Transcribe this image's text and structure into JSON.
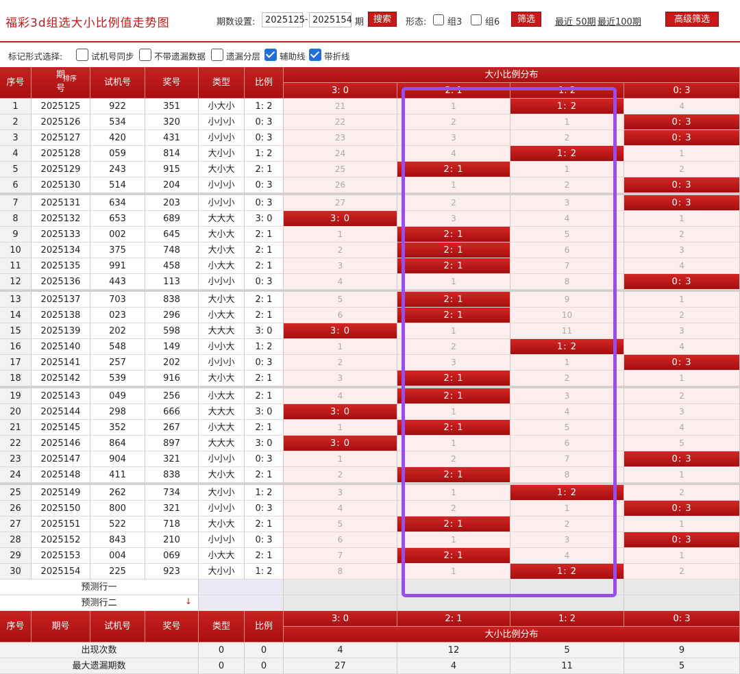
{
  "title": "福彩3d组选大小比例值走势图",
  "toolbar": {
    "period_label": "期数设置:",
    "from": "2025125",
    "dash": "-",
    "to": "2025154",
    "period_unit": "期",
    "search_label": "搜索",
    "form_label": "形态:",
    "group3_label": "组3",
    "group6_label": "组6",
    "filter_label": "筛选",
    "recent50": "最近 50期",
    "recent100": "最近100期",
    "advanced_label": "高级筛选"
  },
  "mark_bar": {
    "label": "标记形式选择:",
    "opt1": "试机号同步",
    "opt2": "不带遗漏数据",
    "opt3": "遗漏分层",
    "opt4": "辅助线",
    "opt5": "带折线",
    "opt4_checked": true,
    "opt5_checked": true
  },
  "headers": {
    "idx": "序号",
    "issue": "期号",
    "sort": "排序",
    "trial": "试机号",
    "draw": "奖号",
    "type": "类型",
    "ratio": "比例",
    "dist": "大小比例分布",
    "cats": [
      "3:0",
      "2:1",
      "1:2",
      "0:3"
    ]
  },
  "rows": [
    {
      "i": "1",
      "issue": "2025125",
      "trial": "922",
      "draw": "351",
      "type": "小大小",
      "ratio": "1:2",
      "d": [
        "21",
        "1",
        "1:2",
        "4"
      ],
      "hit": 2
    },
    {
      "i": "2",
      "issue": "2025126",
      "trial": "534",
      "draw": "320",
      "type": "小小小",
      "ratio": "0:3",
      "d": [
        "22",
        "2",
        "1",
        "0:3"
      ],
      "hit": 3
    },
    {
      "i": "3",
      "issue": "2025127",
      "trial": "420",
      "draw": "431",
      "type": "小小小",
      "ratio": "0:3",
      "d": [
        "23",
        "3",
        "2",
        "0:3"
      ],
      "hit": 3
    },
    {
      "i": "4",
      "issue": "2025128",
      "trial": "059",
      "draw": "814",
      "type": "大小小",
      "ratio": "1:2",
      "d": [
        "24",
        "4",
        "1:2",
        "1"
      ],
      "hit": 2
    },
    {
      "i": "5",
      "issue": "2025129",
      "trial": "243",
      "draw": "915",
      "type": "大小大",
      "ratio": "2:1",
      "d": [
        "25",
        "2:1",
        "1",
        "2"
      ],
      "hit": 1
    },
    {
      "i": "6",
      "issue": "2025130",
      "trial": "514",
      "draw": "204",
      "type": "小小小",
      "ratio": "0:3",
      "d": [
        "26",
        "1",
        "2",
        "0:3"
      ],
      "hit": 3
    },
    {
      "i": "7",
      "issue": "2025131",
      "trial": "634",
      "draw": "203",
      "type": "小小小",
      "ratio": "0:3",
      "d": [
        "27",
        "2",
        "3",
        "0:3"
      ],
      "hit": 3
    },
    {
      "i": "8",
      "issue": "2025132",
      "trial": "653",
      "draw": "689",
      "type": "大大大",
      "ratio": "3:0",
      "d": [
        "3:0",
        "3",
        "4",
        "1"
      ],
      "hit": 0
    },
    {
      "i": "9",
      "issue": "2025133",
      "trial": "002",
      "draw": "645",
      "type": "大小大",
      "ratio": "2:1",
      "d": [
        "1",
        "2:1",
        "5",
        "2"
      ],
      "hit": 1
    },
    {
      "i": "10",
      "issue": "2025134",
      "trial": "375",
      "draw": "748",
      "type": "大小大",
      "ratio": "2:1",
      "d": [
        "2",
        "2:1",
        "6",
        "3"
      ],
      "hit": 1
    },
    {
      "i": "11",
      "issue": "2025135",
      "trial": "991",
      "draw": "458",
      "type": "小大大",
      "ratio": "2:1",
      "d": [
        "3",
        "2:1",
        "7",
        "4"
      ],
      "hit": 1
    },
    {
      "i": "12",
      "issue": "2025136",
      "trial": "443",
      "draw": "113",
      "type": "小小小",
      "ratio": "0:3",
      "d": [
        "4",
        "1",
        "8",
        "0:3"
      ],
      "hit": 3
    },
    {
      "i": "13",
      "issue": "2025137",
      "trial": "703",
      "draw": "838",
      "type": "大小大",
      "ratio": "2:1",
      "d": [
        "5",
        "2:1",
        "9",
        "1"
      ],
      "hit": 1
    },
    {
      "i": "14",
      "issue": "2025138",
      "trial": "023",
      "draw": "296",
      "type": "小大大",
      "ratio": "2:1",
      "d": [
        "6",
        "2:1",
        "10",
        "2"
      ],
      "hit": 1
    },
    {
      "i": "15",
      "issue": "2025139",
      "trial": "202",
      "draw": "598",
      "type": "大大大",
      "ratio": "3:0",
      "d": [
        "3:0",
        "1",
        "11",
        "3"
      ],
      "hit": 0
    },
    {
      "i": "16",
      "issue": "2025140",
      "trial": "548",
      "draw": "149",
      "type": "小小大",
      "ratio": "1:2",
      "d": [
        "1",
        "2",
        "1:2",
        "4"
      ],
      "hit": 2
    },
    {
      "i": "17",
      "issue": "2025141",
      "trial": "257",
      "draw": "202",
      "type": "小小小",
      "ratio": "0:3",
      "d": [
        "2",
        "3",
        "1",
        "0:3"
      ],
      "hit": 3
    },
    {
      "i": "18",
      "issue": "2025142",
      "trial": "539",
      "draw": "916",
      "type": "大小大",
      "ratio": "2:1",
      "d": [
        "3",
        "2:1",
        "2",
        "1"
      ],
      "hit": 1
    },
    {
      "i": "19",
      "issue": "2025143",
      "trial": "049",
      "draw": "256",
      "type": "小大大",
      "ratio": "2:1",
      "d": [
        "4",
        "2:1",
        "3",
        "2"
      ],
      "hit": 1
    },
    {
      "i": "20",
      "issue": "2025144",
      "trial": "298",
      "draw": "666",
      "type": "大大大",
      "ratio": "3:0",
      "d": [
        "3:0",
        "1",
        "4",
        "3"
      ],
      "hit": 0
    },
    {
      "i": "21",
      "issue": "2025145",
      "trial": "352",
      "draw": "267",
      "type": "小大大",
      "ratio": "2:1",
      "d": [
        "1",
        "2:1",
        "5",
        "4"
      ],
      "hit": 1
    },
    {
      "i": "22",
      "issue": "2025146",
      "trial": "864",
      "draw": "897",
      "type": "大大大",
      "ratio": "3:0",
      "d": [
        "3:0",
        "1",
        "6",
        "5"
      ],
      "hit": 0
    },
    {
      "i": "23",
      "issue": "2025147",
      "trial": "904",
      "draw": "321",
      "type": "小小小",
      "ratio": "0:3",
      "d": [
        "1",
        "2",
        "7",
        "0:3"
      ],
      "hit": 3
    },
    {
      "i": "24",
      "issue": "2025148",
      "trial": "411",
      "draw": "838",
      "type": "大小大",
      "ratio": "2:1",
      "d": [
        "2",
        "2:1",
        "8",
        "1"
      ],
      "hit": 1
    },
    {
      "i": "25",
      "issue": "2025149",
      "trial": "262",
      "draw": "734",
      "type": "大小小",
      "ratio": "1:2",
      "d": [
        "3",
        "1",
        "1:2",
        "2"
      ],
      "hit": 2
    },
    {
      "i": "26",
      "issue": "2025150",
      "trial": "800",
      "draw": "321",
      "type": "小小小",
      "ratio": "0:3",
      "d": [
        "4",
        "2",
        "1",
        "0:3"
      ],
      "hit": 3
    },
    {
      "i": "27",
      "issue": "2025151",
      "trial": "522",
      "draw": "718",
      "type": "大小大",
      "ratio": "2:1",
      "d": [
        "5",
        "2:1",
        "2",
        "1"
      ],
      "hit": 1
    },
    {
      "i": "28",
      "issue": "2025152",
      "trial": "843",
      "draw": "210",
      "type": "小小小",
      "ratio": "0:3",
      "d": [
        "6",
        "1",
        "3",
        "0:3"
      ],
      "hit": 3
    },
    {
      "i": "29",
      "issue": "2025153",
      "trial": "004",
      "draw": "069",
      "type": "小大大",
      "ratio": "2:1",
      "d": [
        "7",
        "2:1",
        "4",
        "1"
      ],
      "hit": 1
    },
    {
      "i": "30",
      "issue": "2025154",
      "trial": "225",
      "draw": "923",
      "type": "大小小",
      "ratio": "1:2",
      "d": [
        "8",
        "1",
        "1:2",
        "2"
      ],
      "hit": 2
    }
  ],
  "predict": [
    "预测行一",
    "预测行二"
  ],
  "stats": [
    {
      "label": "出现次数",
      "type": "0",
      "ratio": "0",
      "vals": [
        "4",
        "12",
        "5",
        "9"
      ]
    },
    {
      "label": "最大遗漏期数",
      "type": "0",
      "ratio": "0",
      "vals": [
        "27",
        "4",
        "11",
        "5"
      ]
    }
  ],
  "colors": {
    "accent": "#c81818",
    "highlight": "#9b4cf0",
    "check": "#1e6fd9"
  }
}
